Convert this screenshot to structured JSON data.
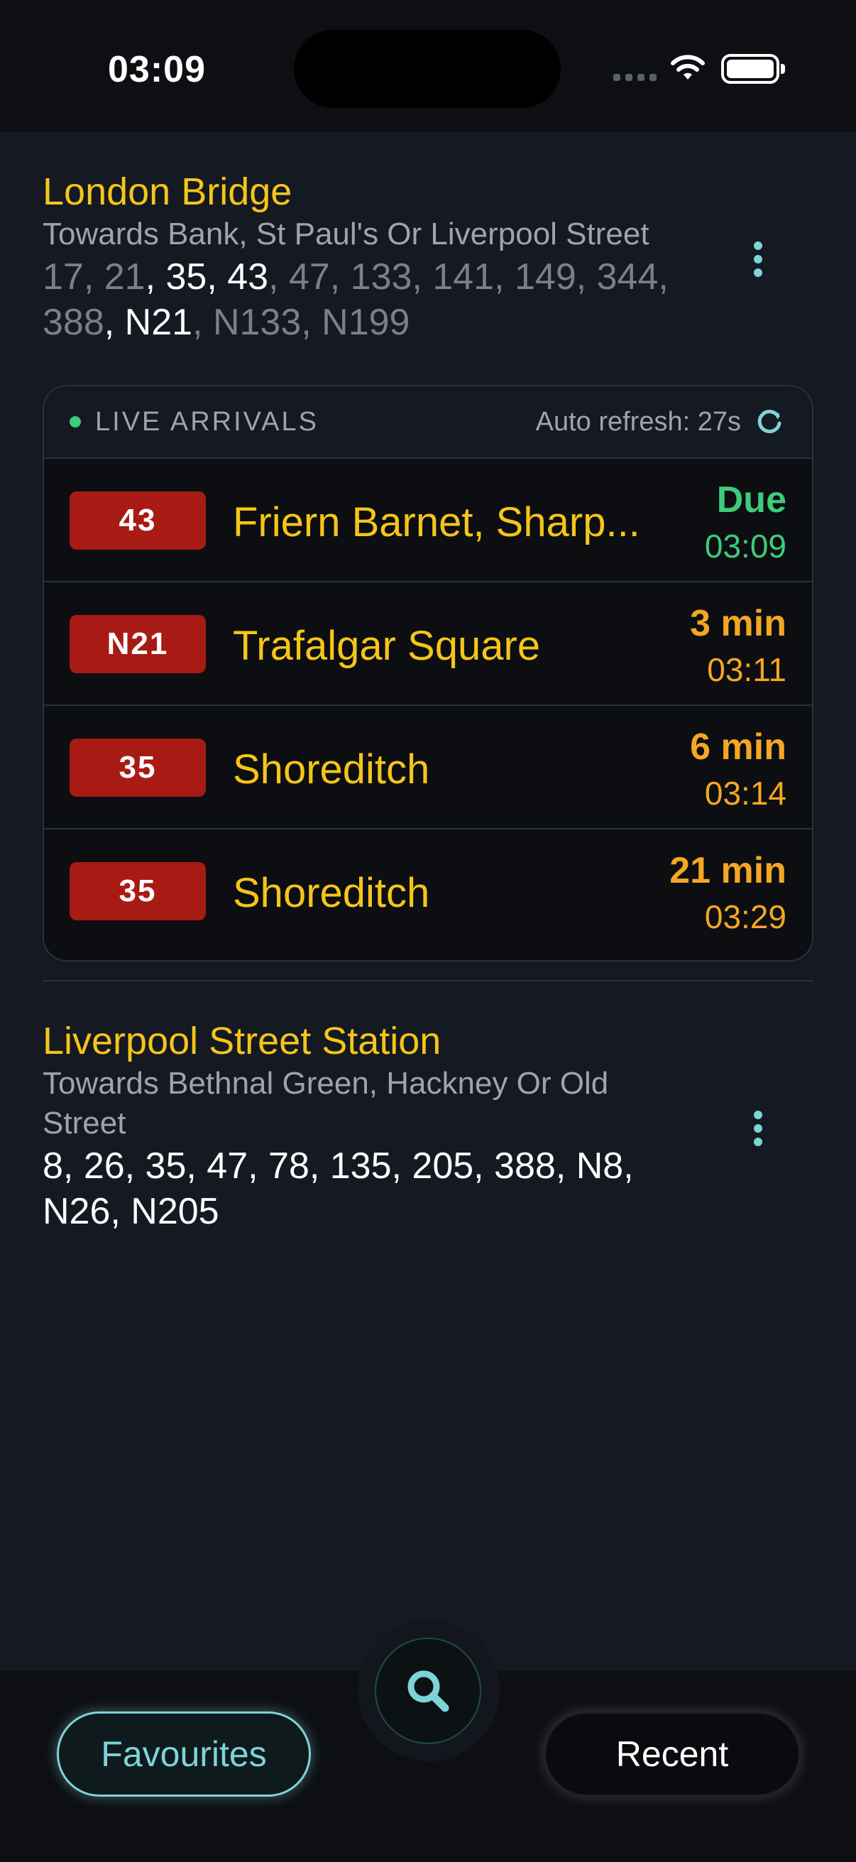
{
  "status": {
    "time": "03:09"
  },
  "stops": [
    {
      "name": "London Bridge",
      "direction": "Towards Bank, St Paul's Or Liverpool Street",
      "routes_line1": [
        {
          "t": "17, 21",
          "hl": false
        },
        {
          "t": ", 35, 43",
          "hl": true
        },
        {
          "t": ", 47, 133, 141, 149, 344,",
          "hl": false
        }
      ],
      "routes_line2": [
        {
          "t": "388",
          "hl": false
        },
        {
          "t": ", N21",
          "hl": true
        },
        {
          "t": ", N133, N199",
          "hl": false
        }
      ]
    },
    {
      "name": "Liverpool Street Station",
      "direction_line1": "Towards Bethnal Green, Hackney Or Old",
      "direction_line2": "Street",
      "routes_line1": "8, 26, 35, 47, 78, 135, 205, 388, N8,",
      "routes_line2": "N26, N205"
    }
  ],
  "live": {
    "label": "LIVE ARRIVALS",
    "refresh": "Auto refresh: 27s",
    "arrivals": [
      {
        "route": "43",
        "destination": "Friern Barnet, Sharp...",
        "eta": "Due",
        "time": "03:09",
        "due": true
      },
      {
        "route": "N21",
        "destination": "Trafalgar Square",
        "eta": "3 min",
        "time": "03:11",
        "due": false
      },
      {
        "route": "35",
        "destination": "Shoreditch",
        "eta": "6 min",
        "time": "03:14",
        "due": false
      },
      {
        "route": "35",
        "destination": "Shoreditch",
        "eta": "21 min",
        "time": "03:29",
        "due": false
      }
    ]
  },
  "nav": {
    "favourites": "Favourites",
    "recent": "Recent"
  },
  "icons": {
    "search": "search-icon",
    "refresh": "refresh-icon",
    "menu": "more-vertical-icon",
    "wifi": "wifi-icon",
    "battery": "battery-icon",
    "signal": "cellular-signal-icon"
  },
  "colors": {
    "accent_yellow": "#f5c518",
    "eta_orange": "#f5a623",
    "due_green": "#3ecb7a",
    "teal": "#7ed3d8",
    "route_red": "#a81b14"
  }
}
